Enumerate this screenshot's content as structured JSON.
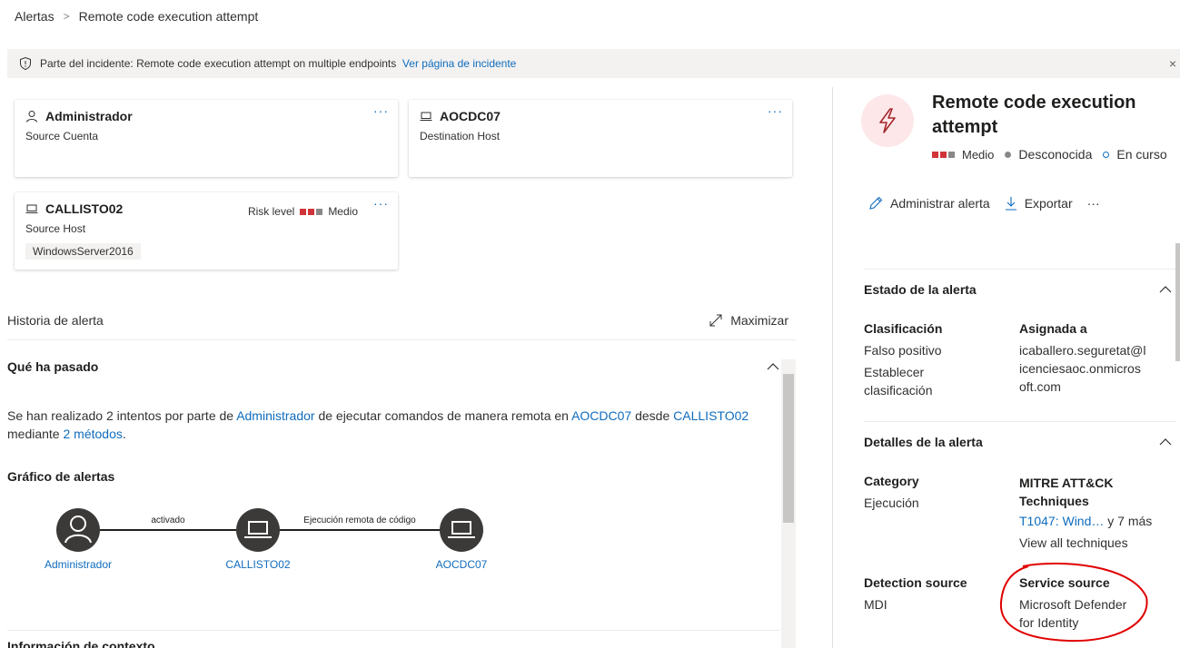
{
  "breadcrumb": {
    "root": "Alertas",
    "separator": ">",
    "current": "Remote code execution attempt"
  },
  "banner": {
    "prefix": "Parte del incidente:",
    "incident_name": "Remote code execution attempt on multiple endpoints",
    "link": "Ver página de incidente",
    "close": "×"
  },
  "cards": {
    "account": {
      "title": "Administrador",
      "subtitle": "Source Cuenta",
      "more": "···"
    },
    "dest_host": {
      "title": "AOCDC07",
      "subtitle": "Destination Host",
      "more": "···"
    },
    "source_host": {
      "title": "CALLISTO02",
      "subtitle": "Source Host",
      "os": "WindowsServer2016",
      "risk_label": "Risk level",
      "risk_value": "Medio",
      "more": "···"
    }
  },
  "history": {
    "title": "Historia de alerta",
    "maximize": "Maximizar",
    "what_happened": "Qué ha pasado",
    "story": {
      "t1": "Se han realizado 2 intentos por parte de ",
      "l1": "Administrador",
      "t2": " de ejecutar comandos de manera remota en ",
      "l2": "AOCDC07",
      "t3": " desde ",
      "l3": "CALLISTO02",
      "t4": " mediante ",
      "l4": "2 métodos",
      "t5": "."
    },
    "graph_title": "Gráfico de alertas",
    "graph": {
      "nodes": [
        "Administrador",
        "CALLISTO02",
        "AOCDC07"
      ],
      "edges": [
        "activado",
        "Ejecución remota de código"
      ]
    },
    "next_section_partial": "Información de contexto"
  },
  "panel": {
    "title": "Remote code execution attempt",
    "severity": "Medio",
    "determination": "Desconocida",
    "status": "En curso",
    "actions": {
      "manage": "Administrar alerta",
      "export": "Exportar",
      "more": "···"
    },
    "state_section": {
      "title": "Estado de la alerta",
      "classification_label": "Clasificación",
      "classification_value": "Falso positivo",
      "set_classification": "Establecer clasificación",
      "assigned_label": "Asignada a",
      "assigned_value": "icaballero.seguretat@licenciesaoc.onmicrosoft.com"
    },
    "details_section": {
      "title": "Detalles de la alerta",
      "category_label": "Category",
      "category_value": "Ejecución",
      "mitre_label": "MITRE ATT&CK Techniques",
      "mitre_value": "T1047: Wind…",
      "mitre_more": "y 7 más",
      "view_all": "View all techniques",
      "detection_label": "Detection source",
      "detection_value": "MDI",
      "service_label": "Service source",
      "service_value": "Microsoft Defender for Identity"
    }
  },
  "colors": {
    "accent": "#0f6cbd",
    "severity_red": "#d13438",
    "severity_gray": "#8a8886",
    "node_dark": "#3b3a39",
    "annotation_red": "#e00000"
  }
}
